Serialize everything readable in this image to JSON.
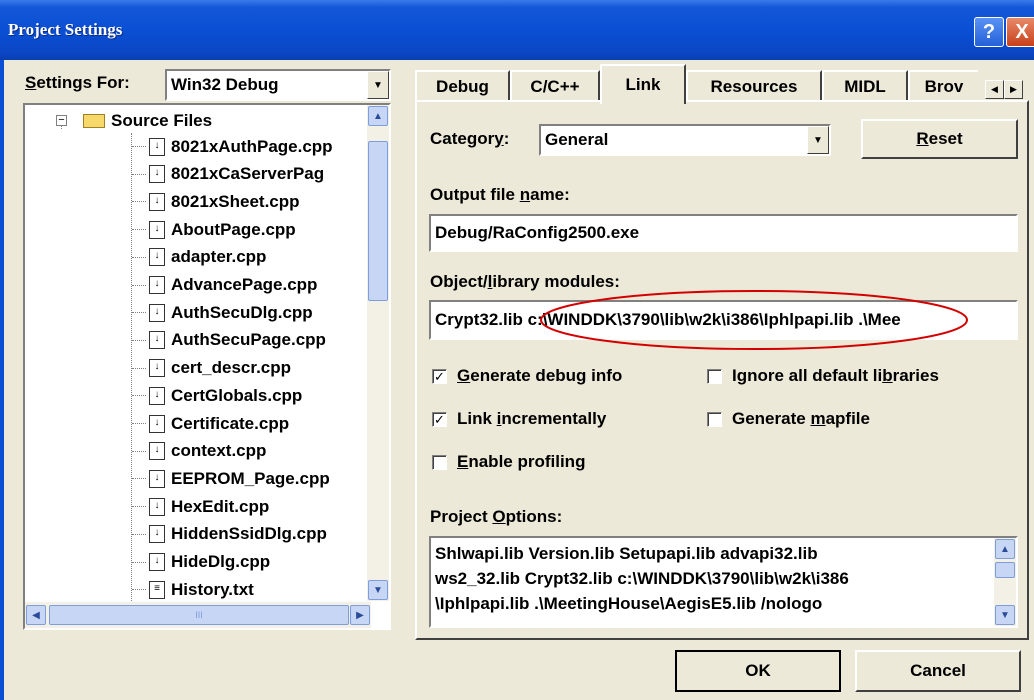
{
  "window": {
    "title": "Project Settings",
    "help_glyph": "?",
    "close_glyph": "X"
  },
  "settings_for": {
    "label_prefix": "S",
    "label_rest": "ettings For:",
    "value": "Win32 Debug"
  },
  "tree": {
    "root": "Source Files",
    "files": [
      "8021xAuthPage.cpp",
      "8021xCaServerPag",
      "8021xSheet.cpp",
      "AboutPage.cpp",
      "adapter.cpp",
      "AdvancePage.cpp",
      "AuthSecuDlg.cpp",
      "AuthSecuPage.cpp",
      "cert_descr.cpp",
      "CertGlobals.cpp",
      "Certificate.cpp",
      "context.cpp",
      "EEPROM_Page.cpp",
      "HexEdit.cpp",
      "HiddenSsidDlg.cpp",
      "HideDlg.cpp",
      "History.txt"
    ],
    "hscroll_grip": "III"
  },
  "tabs": [
    {
      "label": "Debug"
    },
    {
      "label": "C/C++"
    },
    {
      "label": "Link"
    },
    {
      "label": "Resources"
    },
    {
      "label": "MIDL"
    },
    {
      "label": "Brov"
    }
  ],
  "active_tab": "Link",
  "link": {
    "category_pre": "Categor",
    "category_ul": "y",
    "category_post": ":",
    "category_value": "General",
    "reset_ul": "R",
    "reset_rest": "eset",
    "output_pre": "Output file ",
    "output_ul": "n",
    "output_post": "ame:",
    "output_value": "Debug/RaConfig2500.exe",
    "objlib_pre": "Object/",
    "objlib_ul": "l",
    "objlib_post": "ibrary modules:",
    "objlib_value": "Crypt32.lib c:\\WINDDK\\3790\\lib\\w2k\\i386\\Iphlpapi.lib .\\Mee",
    "checkboxes": {
      "gen_debug": {
        "ul": "G",
        "rest": "enerate debug info",
        "checked": true
      },
      "link_incr": {
        "pre": "Link ",
        "ul": "i",
        "rest": "ncrementally",
        "checked": true
      },
      "profiling": {
        "ul": "E",
        "rest": "nable profiling",
        "checked": false
      },
      "ignore_libs": {
        "pre": "Ignore all default li",
        "ul": "b",
        "rest": "raries",
        "checked": false
      },
      "mapfile": {
        "pre": "Generate ",
        "ul": "m",
        "rest": "apfile",
        "checked": false
      }
    },
    "project_options_pre": "Project ",
    "project_options_ul": "O",
    "project_options_post": "ptions:",
    "project_options_lines": [
      "Shlwapi.lib Version.lib Setupapi.lib advapi32.lib",
      "ws2_32.lib Crypt32.lib c:\\WINDDK\\3790\\lib\\w2k\\i386",
      "\\Iphlpapi.lib .\\MeetingHouse\\AegisE5.lib /nologo"
    ]
  },
  "buttons": {
    "ok": "OK",
    "cancel": "Cancel"
  },
  "colors": {
    "titlebar": "#0a4fd4",
    "face": "#ece9d8",
    "annotation": "#d40000"
  },
  "icons": {
    "help": "help-icon",
    "close": "close-icon",
    "folder": "folder-icon",
    "file": "file-icon",
    "combo_arrow": "chevron-down-icon"
  }
}
